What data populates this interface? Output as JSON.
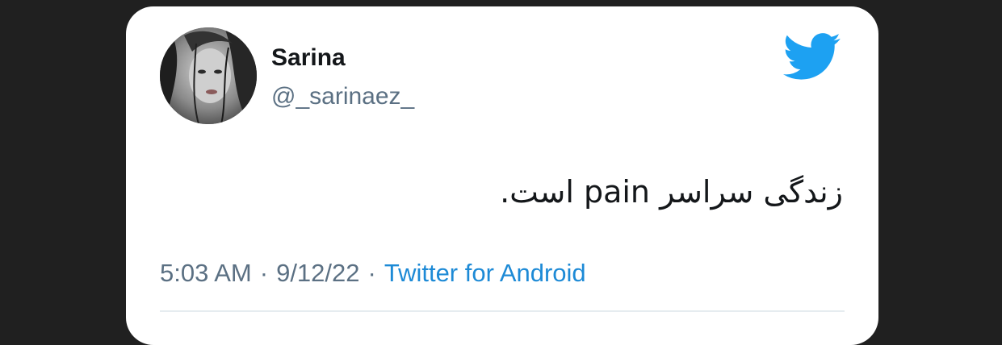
{
  "tweet": {
    "author": {
      "display_name": "Sarina",
      "handle": "@_sarinaez_",
      "avatar_icon": "profile-photo"
    },
    "logo_icon": "twitter-bird-icon",
    "logo_color": "#1da1f2",
    "text": "زندگی سراسر pain است.",
    "meta": {
      "time": "5:03 AM",
      "separator": "·",
      "date": "9/12/22",
      "source": "Twitter for Android"
    }
  }
}
